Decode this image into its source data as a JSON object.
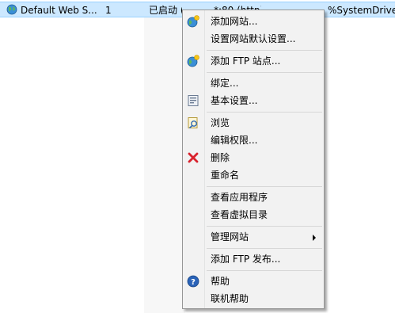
{
  "list": {
    "row": {
      "name": "Default Web S...",
      "id": "1",
      "status": "已启动 (ht",
      "binding": "*:80 (http)",
      "path": "%SystemDrive"
    }
  },
  "menu": {
    "items": [
      {
        "label": "添加网站...",
        "icon": "globe-add-icon"
      },
      {
        "label": "设置网站默认设置..."
      },
      {
        "label": "添加 FTP 站点...",
        "icon": "globe-add-icon"
      },
      {
        "label": "绑定..."
      },
      {
        "label": "基本设置...",
        "icon": "settings-page-icon"
      },
      {
        "label": "浏览",
        "icon": "browse-icon"
      },
      {
        "label": "编辑权限..."
      },
      {
        "label": "删除",
        "icon": "red-x-icon"
      },
      {
        "label": "重命名"
      },
      {
        "label": "查看应用程序"
      },
      {
        "label": "查看虚拟目录"
      },
      {
        "label": "管理网站"
      },
      {
        "label": "添加 FTP 发布..."
      },
      {
        "label": "帮助",
        "icon": "help-icon"
      },
      {
        "label": "联机帮助"
      }
    ]
  },
  "colors": {
    "selection": "#cce8ff",
    "menu_bg": "#f2f2f2",
    "delete_red": "#d9232e",
    "help_blue": "#2a63b8"
  }
}
